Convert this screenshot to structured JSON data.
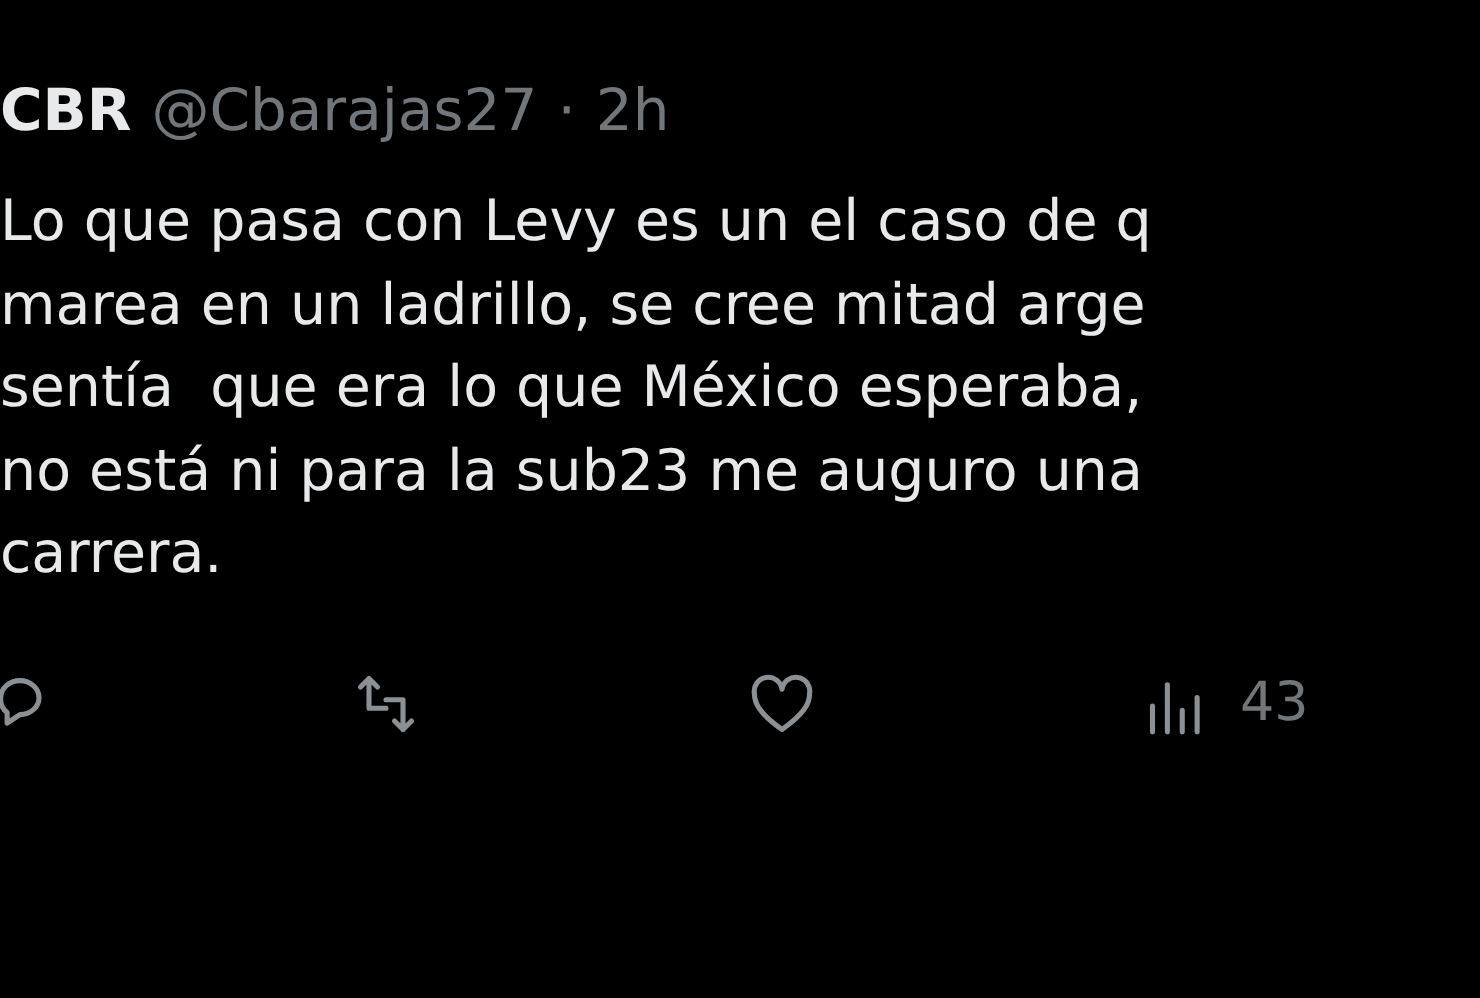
{
  "author": {
    "name": "CBR",
    "handle": "@Cbarajas27",
    "separator": "·",
    "time": "2h"
  },
  "text_lines": [
    "Lo que pasa con Levy es un el caso de q",
    "marea en un ladrillo, se cree mitad arge",
    "sentía  que era lo que México esperaba,",
    "no está ni para la sub23 me auguro una",
    "carrera."
  ],
  "actions": [
    {
      "kind": "reply"
    },
    {
      "kind": "repost"
    },
    {
      "kind": "like"
    },
    {
      "kind": "views",
      "count": "43"
    }
  ]
}
